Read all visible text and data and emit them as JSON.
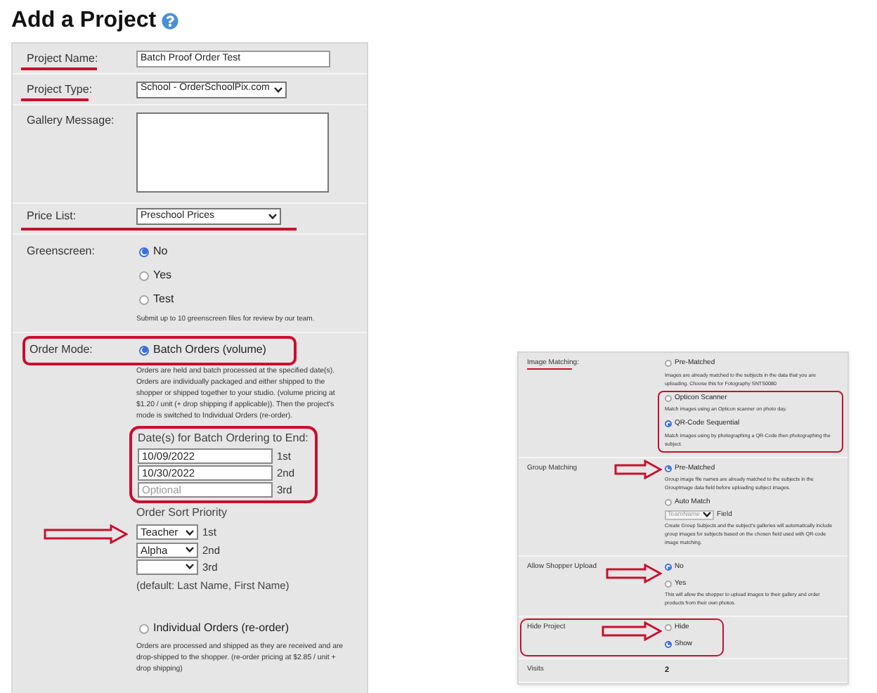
{
  "page": {
    "title": "Add a Project"
  },
  "project_form": {
    "project_name": {
      "label": "Project Name:",
      "value": "Batch Proof Order Test"
    },
    "project_type": {
      "label": "Project Type:",
      "value": "School - OrderSchoolPix.com"
    },
    "gallery_message": {
      "label": "Gallery Message:"
    },
    "price_list": {
      "label": "Price List:",
      "value": "Preschool Prices"
    },
    "greenscreen": {
      "label": "Greenscreen:",
      "options": [
        {
          "label": "No",
          "selected": true
        },
        {
          "label": "Yes",
          "selected": false
        },
        {
          "label": "Test",
          "selected": false
        }
      ],
      "note": "Submit up to 10 greenscreen files for review by our team."
    },
    "order_mode": {
      "label": "Order Mode:",
      "batch": {
        "label": "Batch Orders (volume)",
        "selected": true,
        "description": "Orders are held and batch processed at the specified date(s). Orders are individually packaged and either shipped to the shopper or shipped together to your studio. (volume pricing at $1.20 / unit (+ drop shipping if applicable)). Then the project's mode is switched to Individual Orders (re-order)."
      },
      "dates": {
        "heading": "Date(s) for Batch Ordering to End:",
        "fields": [
          {
            "value": "10/09/2022",
            "ordinal": "1st"
          },
          {
            "value": "10/30/2022",
            "ordinal": "2nd"
          },
          {
            "placeholder": "Optional",
            "ordinal": "3rd"
          }
        ]
      },
      "sort": {
        "heading": "Order Sort Priority",
        "selects": [
          {
            "value": "Teacher",
            "ordinal": "1st"
          },
          {
            "value": "Alpha",
            "ordinal": "2nd"
          },
          {
            "ordinal": "3rd"
          }
        ],
        "note": "(default: Last Name, First Name)"
      },
      "individual": {
        "label": "Individual Orders (re-order)",
        "selected": false,
        "description": "Orders are processed and shipped as they are received and are drop-shipped to the shopper. (re-order pricing at $2.85 / unit + drop shipping)"
      }
    }
  },
  "settings_panel": {
    "rows": [
      {
        "label": "Image Matching:",
        "options": [
          {
            "label": "Pre-Matched",
            "selected": false,
            "description": "Images are already matched to the subjects in the data that you are uploading. Choose this for Fotography SNTS0080"
          },
          {
            "label": "Opticon Scanner",
            "selected": false,
            "description": "Match images using an Opticon scanner on photo day."
          },
          {
            "label": "QR-Code Sequential",
            "selected": true,
            "description": "Match images using by photographing a QR-Code then photographing the subject."
          }
        ]
      },
      {
        "label": "Group Matching",
        "options": [
          {
            "label": "Pre-Matched",
            "selected": true,
            "description": "Group image file names are already matched to the subjects in the GroupImage data field before uploading subject images."
          },
          {
            "label": "Auto Match",
            "selected": false,
            "field_select": "TeamName",
            "field_label": "Field",
            "description": "Create Group Subjects and the subject's galleries will automatically include group images for subjects based on the chosen field used with QR-code image matching."
          }
        ]
      },
      {
        "label": "Allow Shopper Upload",
        "options": [
          {
            "label": "No",
            "selected": true
          },
          {
            "label": "Yes",
            "selected": false,
            "description": "This will allow the shopper to upload images to their gallery and order products from their own photos."
          }
        ]
      },
      {
        "label": "Hide Project",
        "options": [
          {
            "label": "Hide",
            "selected": false
          },
          {
            "label": "Show",
            "selected": true
          }
        ]
      },
      {
        "label": "Visits",
        "value": "2"
      }
    ]
  }
}
